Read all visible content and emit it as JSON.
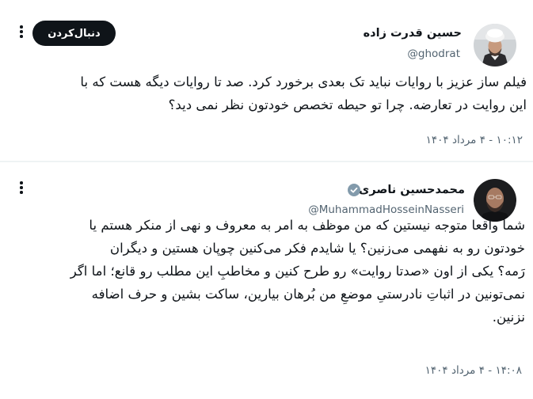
{
  "posts": [
    {
      "author_name": "حسین قدرت زاده",
      "handle": "@ghodrat",
      "follow_label": "دنبال‌کردن",
      "text_lines": [
        "فیلم ساز عزیز با روایات نباید تک بعدی برخورد کرد. صد تا روایات دیگه هست که با",
        "این روایت در تعارضه. چرا تو حیطه تخصص خودتون نظر نمی دید؟"
      ],
      "timestamp": "۱۰:۱۲ - ۴ مرداد ۱۴۰۴",
      "avatar_icon": "cleric-avatar"
    },
    {
      "author_name": "محمدحسین ناصری",
      "handle": "@MuhammadHosseinNasseri",
      "verified": true,
      "verified_icon": "verified-badge-icon",
      "text_lines": [
        "شما واقعا متوجه نیستین که من موظف به امر به معروف و نهی از منکر هستم یا",
        "خودتون رو به نفهمی می‌زنین؟ یا شایدم فکر می‌کنین چوپان هستین و دیگران",
        "رَمه؟ یکی از اون «صدتا روایت» رو طرح کنین و مخاطبِ این مطلب رو قانع؛ اما اگر",
        "نمی‌تونین در اثباتِ نادرستیِ موضعِ من بُرهان بیارین، ساکت بشین و حرف اضافه",
        "نزنین."
      ],
      "timestamp": "۱۴:۰۸ - ۴ مرداد ۱۴۰۴",
      "avatar_icon": "bald-man-avatar"
    }
  ],
  "colors": {
    "text_primary": "#0f1419",
    "text_secondary": "#536471",
    "follow_button_bg": "#0f1419",
    "verified_badge": "#829aab",
    "separator": "#eff3f4"
  }
}
